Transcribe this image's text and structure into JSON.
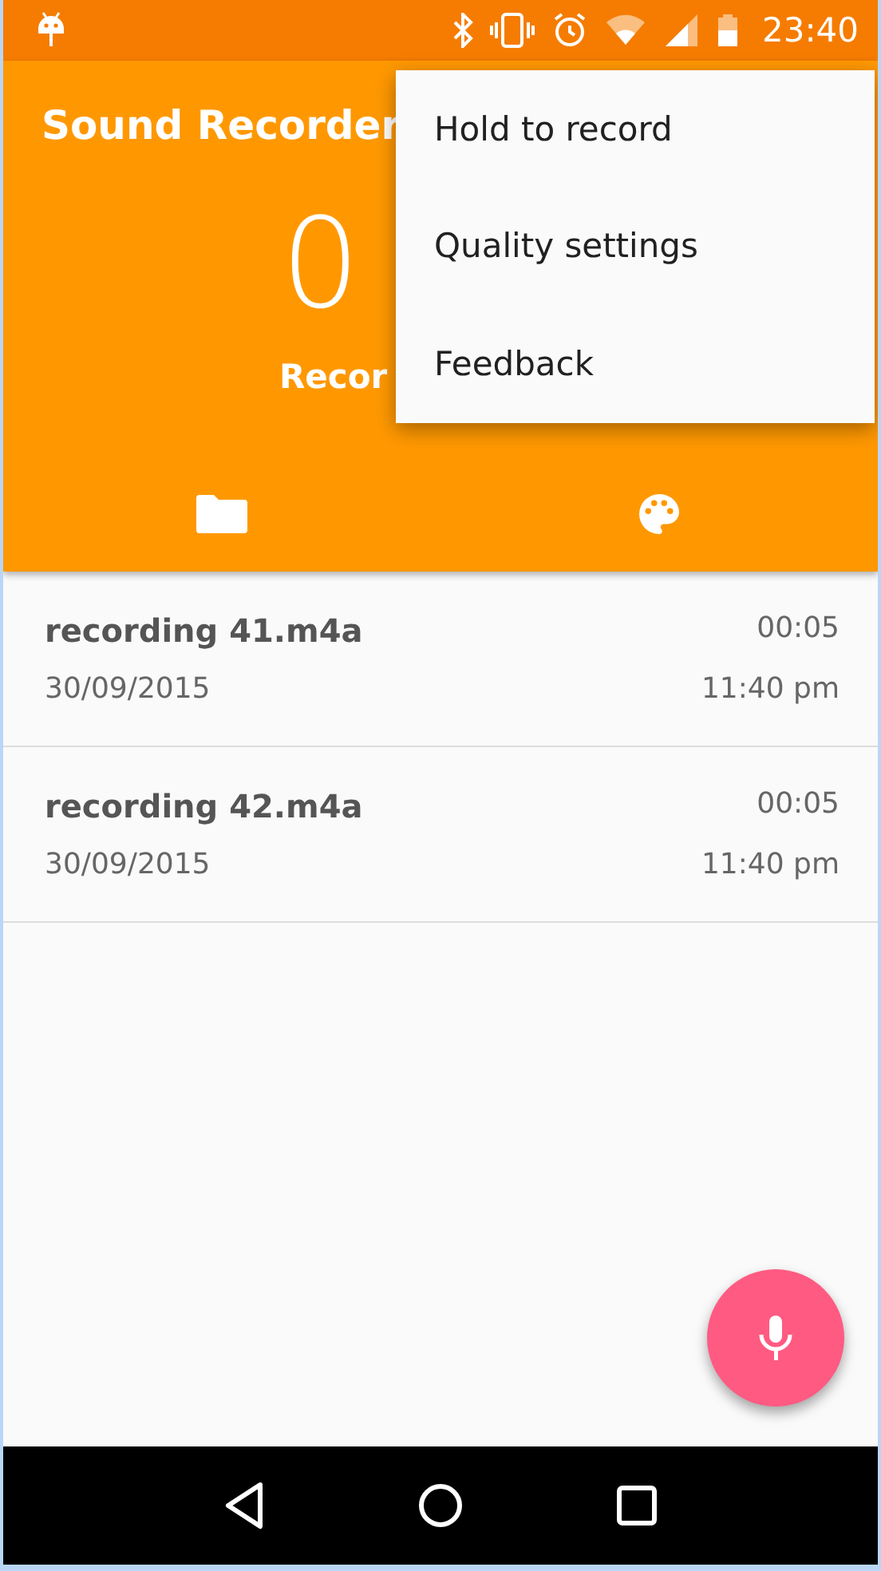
{
  "status_bar": {
    "time": "23:40"
  },
  "app_bar": {
    "title": "Sound Recorder",
    "timer": "0",
    "subtitle": "Recor"
  },
  "tabs": [
    {
      "kind": "folder"
    },
    {
      "kind": "palette"
    }
  ],
  "recordings": [
    {
      "name": "recording 41.m4a",
      "duration": "00:05",
      "date": "30/09/2015",
      "time": "11:40 pm"
    },
    {
      "name": "recording 42.m4a",
      "duration": "00:05",
      "date": "30/09/2015",
      "time": "11:40 pm"
    }
  ],
  "overflow_menu": {
    "items": [
      "Hold to record",
      "Quality settings",
      "Feedback"
    ]
  }
}
